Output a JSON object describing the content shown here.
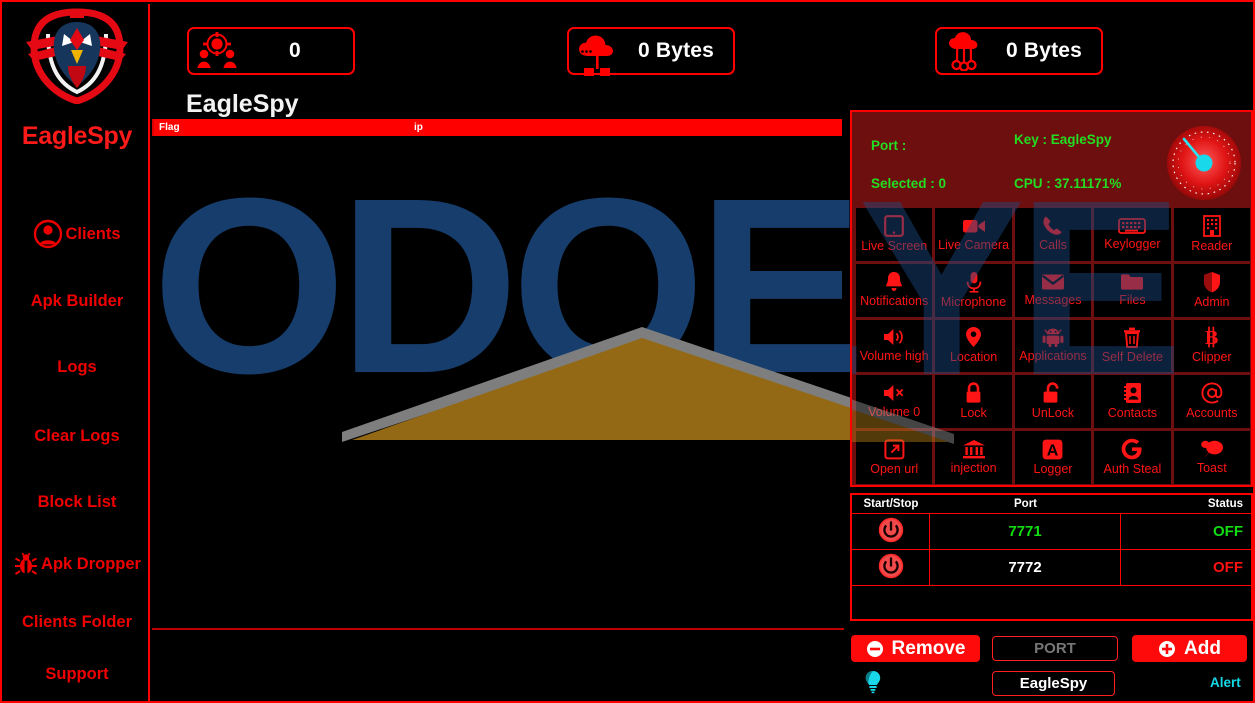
{
  "app": {
    "title": "EagleSpy",
    "brand": "EagleSpy"
  },
  "sidebar": {
    "logo_icon": "eagle-logo-icon",
    "brand": "EagleSpy",
    "items": [
      {
        "label": "Clients",
        "icon": "user-circle-icon"
      },
      {
        "label": "Apk Builder",
        "icon": ""
      },
      {
        "label": "Logs",
        "icon": ""
      },
      {
        "label": "Clear Logs",
        "icon": ""
      },
      {
        "label": "Block List",
        "icon": ""
      },
      {
        "label": "Apk Dropper",
        "icon": "bug-icon"
      },
      {
        "label": "Clients Folder",
        "icon": ""
      },
      {
        "label": "Support",
        "icon": ""
      }
    ]
  },
  "stats": [
    {
      "icon": "clients-network-icon",
      "value": "0"
    },
    {
      "icon": "cloud-upload-icon",
      "value": "0 Bytes"
    },
    {
      "icon": "cloud-network-icon",
      "value": "0 Bytes"
    }
  ],
  "main": {
    "title": "EagleSpy",
    "table_headers": [
      "Flag",
      "ip"
    ],
    "rows": []
  },
  "watermark": {
    "text": "ODOEYE"
  },
  "right_panel": {
    "port_label": "Port :",
    "key_label": "Key : EagleSpy",
    "selected_label": "Selected : 0",
    "cpu_label": "CPU : 37.11171%",
    "gauge_icon": "speedometer-icon",
    "commands": [
      {
        "label": "Live Screen",
        "icon": "tablet-icon"
      },
      {
        "label": "Live Camera",
        "icon": "video-camera-icon"
      },
      {
        "label": "Calls",
        "icon": "phone-icon"
      },
      {
        "label": "Keylogger",
        "icon": "keyboard-icon"
      },
      {
        "label": "Reader",
        "icon": "building-icon"
      },
      {
        "label": "Notifications",
        "icon": "bell-icon"
      },
      {
        "label": "Microphone",
        "icon": "microphone-icon"
      },
      {
        "label": "Messages",
        "icon": "envelope-icon"
      },
      {
        "label": "Files",
        "icon": "folder-icon"
      },
      {
        "label": "Admin",
        "icon": "shield-icon"
      },
      {
        "label": "Volume high",
        "icon": "volume-high-icon"
      },
      {
        "label": "Location",
        "icon": "map-pin-icon"
      },
      {
        "label": "Applications",
        "icon": "android-icon"
      },
      {
        "label": "Self Delete",
        "icon": "trash-icon"
      },
      {
        "label": "Clipper",
        "icon": "bitcoin-icon"
      },
      {
        "label": "Volume 0",
        "icon": "volume-mute-icon"
      },
      {
        "label": "Lock",
        "icon": "lock-closed-icon"
      },
      {
        "label": "UnLock",
        "icon": "lock-open-icon"
      },
      {
        "label": "Contacts",
        "icon": "contacts-icon"
      },
      {
        "label": "Accounts",
        "icon": "at-sign-icon"
      },
      {
        "label": "Open url",
        "icon": "external-link-icon"
      },
      {
        "label": "injection",
        "icon": "bank-icon"
      },
      {
        "label": "Logger",
        "icon": "a-box-icon"
      },
      {
        "label": "Auth Steal",
        "icon": "google-g-icon"
      },
      {
        "label": "Toast",
        "icon": "chat-bubble-icon"
      }
    ]
  },
  "port_table": {
    "headers": [
      "Start/Stop",
      "Port",
      "Status"
    ],
    "rows": [
      {
        "power_icon": "power-icon",
        "port": "7771",
        "port_color": "#11dd11",
        "status": "OFF",
        "status_color": "#11dd11"
      },
      {
        "power_icon": "power-icon",
        "port": "7772",
        "port_color": "#ffffff",
        "status": "OFF",
        "status_color": "#ff1111"
      }
    ]
  },
  "footer": {
    "remove_label": "Remove",
    "remove_icon": "minus-circle-icon",
    "add_label": "Add",
    "add_icon": "plus-circle-icon",
    "port_input_value": "PORT",
    "key_input_value": "EagleSpy",
    "bulb_icon": "lightbulb-icon",
    "alert_label": "Alert"
  },
  "colors": {
    "accent": "#ff0000",
    "panel_bg": "#6e0f0f",
    "green": "#22dd22",
    "cyan": "#14d8e6",
    "watermark_blue": "#1b4b84",
    "watermark_gold": "#b5801a"
  }
}
